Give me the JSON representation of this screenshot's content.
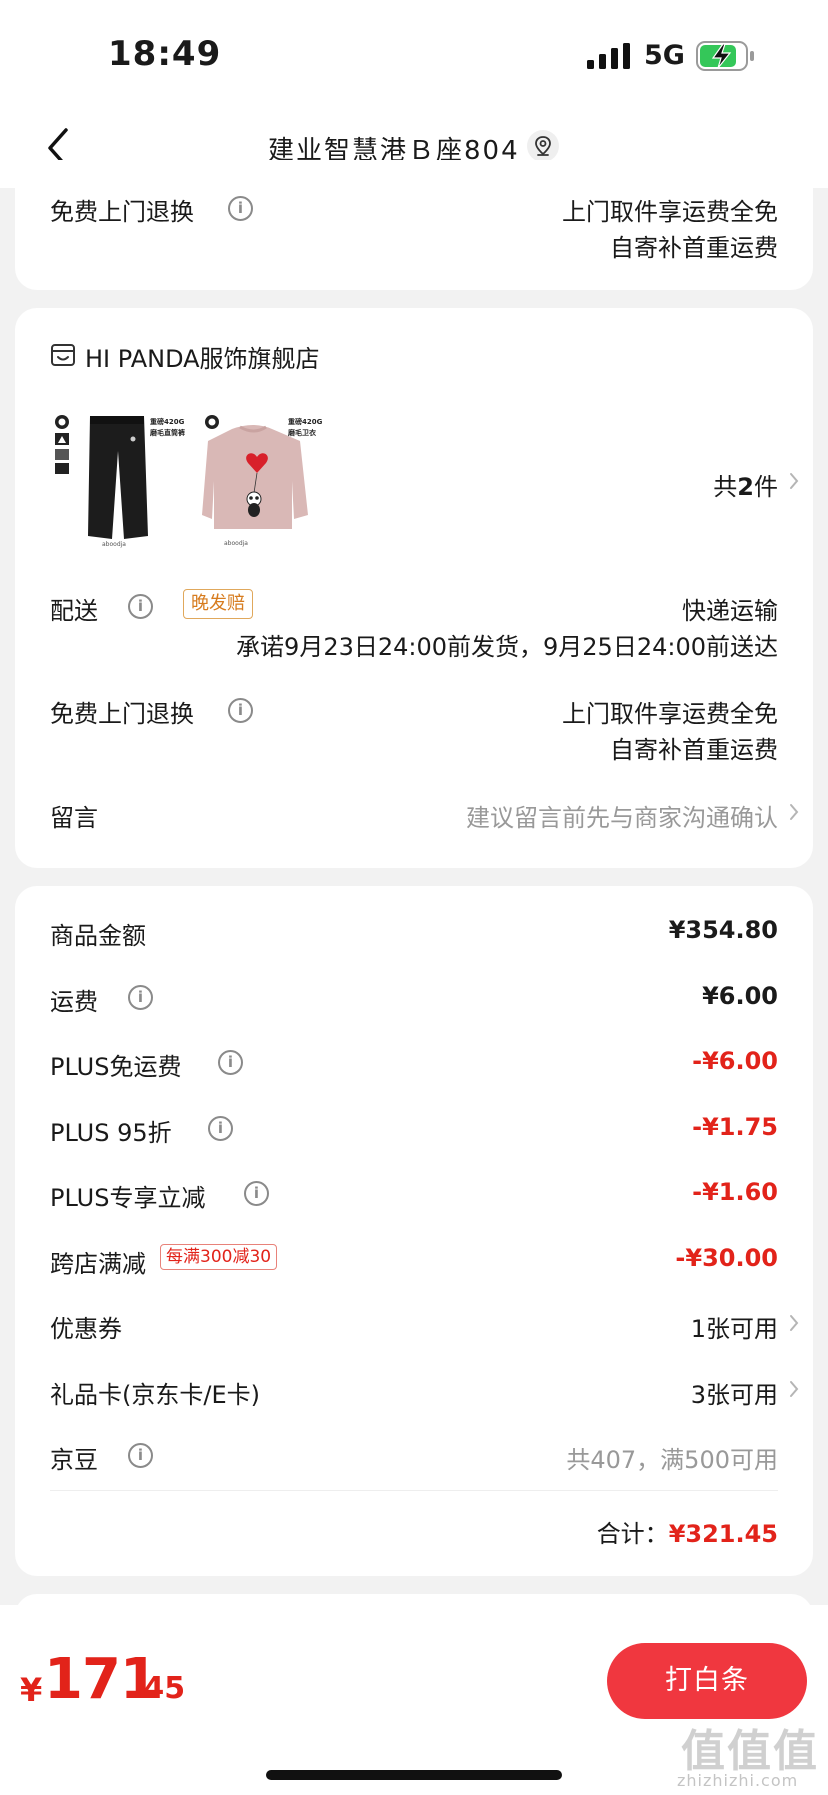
{
  "status_bar": {
    "time": "18:49",
    "network": "5G"
  },
  "nav": {
    "title": "建业智慧港Ｂ座804"
  },
  "return_top": {
    "label": "免费上门退换",
    "line1": "上门取件享运费全免",
    "line2": "自寄补首重运费"
  },
  "store": {
    "name": "HI PANDA服饰旗舰店",
    "products": [
      {
        "name": "pants",
        "tag": "重磅420G",
        "sub": "磨毛直筒裤"
      },
      {
        "name": "sweatshirt",
        "tag": "重磅420G",
        "sub": "磨毛卫衣"
      }
    ],
    "count_prefix": "共",
    "count_num": "2",
    "count_suffix": "件",
    "delivery_label": "配送",
    "delivery_badge": "晚发赔",
    "delivery_method": "快递运输",
    "delivery_promise": "承诺9月23日24:00前发货，9月25日24:00前送达",
    "return_label": "免费上门退换",
    "return_line1": "上门取件享运费全免",
    "return_line2": "自寄补首重运费",
    "message_label": "留言",
    "message_placeholder": "建议留言前先与商家沟通确认"
  },
  "price": {
    "goods_label": "商品金额",
    "goods_value": "¥354.80",
    "shipping_label": "运费",
    "shipping_value": "¥6.00",
    "plus_free_label": "PLUS免运费",
    "plus_free_value": "-¥6.00",
    "plus95_label": "PLUS 95折",
    "plus95_value": "-¥1.75",
    "plus_reduce_label": "PLUS专享立减",
    "plus_reduce_value": "-¥1.60",
    "cross_label": "跨店满减",
    "cross_badge": "每满300减30",
    "cross_value": "-¥30.00",
    "coupon_label": "优惠券",
    "coupon_value": "1张可用",
    "gift_label": "礼品卡(京东卡/E卡)",
    "gift_value": "3张可用",
    "bean_label": "京豆",
    "bean_value": "共407，满500可用",
    "total_label": "合计：",
    "total_value": "¥321.45"
  },
  "bottom": {
    "symbol": "¥",
    "integer": "171",
    "decimal": ".45",
    "button_label": "打白条",
    "watermark": "值值值",
    "watermark_url": "zhizhizhi.com"
  },
  "colors": {
    "accent": "#e2231a",
    "button": "#f0373f",
    "badge_orange": "#d77c1f"
  }
}
